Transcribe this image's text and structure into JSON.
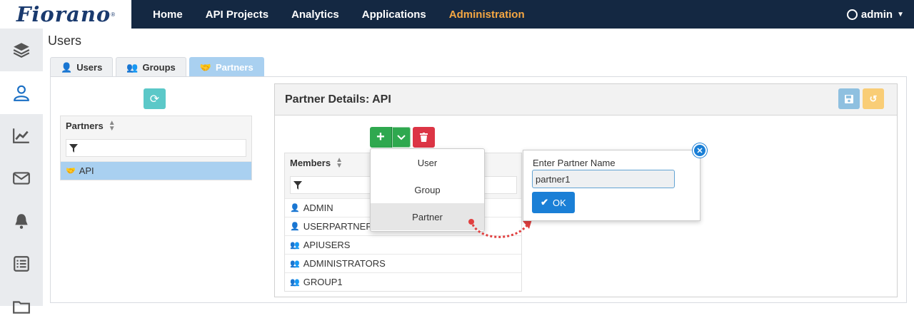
{
  "brand": {
    "logo_text": "Fiorano"
  },
  "nav": {
    "items": [
      "Home",
      "API Projects",
      "Analytics",
      "Applications",
      "Administration"
    ],
    "active": "Administration",
    "user": "admin"
  },
  "page": {
    "title": "Users"
  },
  "tabs": [
    {
      "label": "Users"
    },
    {
      "label": "Groups"
    },
    {
      "label": "Partners"
    }
  ],
  "partners_table": {
    "header": "Partners",
    "rows": [
      "API"
    ]
  },
  "details": {
    "title": "Partner Details: API"
  },
  "members_table": {
    "header": "Members",
    "rows": [
      {
        "type": "user",
        "name": "ADMIN"
      },
      {
        "type": "user",
        "name": "USERPARTNER1"
      },
      {
        "type": "group",
        "name": "APIUSERS"
      },
      {
        "type": "group",
        "name": "ADMINISTRATORS"
      },
      {
        "type": "group",
        "name": "GROUP1"
      }
    ]
  },
  "add_dropdown": {
    "items": [
      "User",
      "Group",
      "Partner"
    ],
    "hovered": "Partner"
  },
  "popover": {
    "label": "Enter Partner Name",
    "value": "partner1",
    "ok_label": "OK"
  },
  "colors": {
    "nav_bg": "#142842",
    "active_nav": "#f5a742",
    "add_green": "#2fa84f",
    "delete_red": "#dc3545",
    "ok_blue": "#1a7fd6"
  }
}
